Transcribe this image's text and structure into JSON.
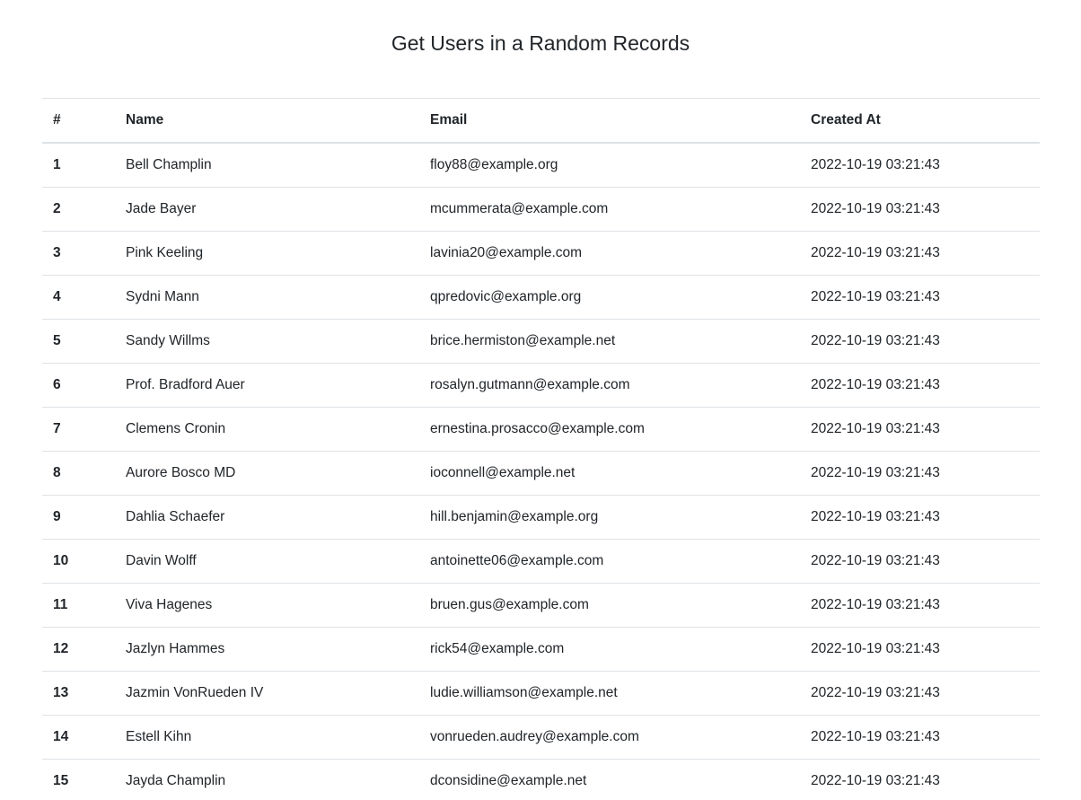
{
  "page": {
    "title": "Get Users in a Random Records"
  },
  "table": {
    "headers": {
      "number": "#",
      "name": "Name",
      "email": "Email",
      "created_at": "Created At"
    },
    "rows": [
      {
        "number": "1",
        "name": "Bell Champlin",
        "email": "floy88@example.org",
        "created_at": "2022-10-19 03:21:43"
      },
      {
        "number": "2",
        "name": "Jade Bayer",
        "email": "mcummerata@example.com",
        "created_at": "2022-10-19 03:21:43"
      },
      {
        "number": "3",
        "name": "Pink Keeling",
        "email": "lavinia20@example.com",
        "created_at": "2022-10-19 03:21:43"
      },
      {
        "number": "4",
        "name": "Sydni Mann",
        "email": "qpredovic@example.org",
        "created_at": "2022-10-19 03:21:43"
      },
      {
        "number": "5",
        "name": "Sandy Willms",
        "email": "brice.hermiston@example.net",
        "created_at": "2022-10-19 03:21:43"
      },
      {
        "number": "6",
        "name": "Prof. Bradford Auer",
        "email": "rosalyn.gutmann@example.com",
        "created_at": "2022-10-19 03:21:43"
      },
      {
        "number": "7",
        "name": "Clemens Cronin",
        "email": "ernestina.prosacco@example.com",
        "created_at": "2022-10-19 03:21:43"
      },
      {
        "number": "8",
        "name": "Aurore Bosco MD",
        "email": "ioconnell@example.net",
        "created_at": "2022-10-19 03:21:43"
      },
      {
        "number": "9",
        "name": "Dahlia Schaefer",
        "email": "hill.benjamin@example.org",
        "created_at": "2022-10-19 03:21:43"
      },
      {
        "number": "10",
        "name": "Davin Wolff",
        "email": "antoinette06@example.com",
        "created_at": "2022-10-19 03:21:43"
      },
      {
        "number": "11",
        "name": "Viva Hagenes",
        "email": "bruen.gus@example.com",
        "created_at": "2022-10-19 03:21:43"
      },
      {
        "number": "12",
        "name": "Jazlyn Hammes",
        "email": "rick54@example.com",
        "created_at": "2022-10-19 03:21:43"
      },
      {
        "number": "13",
        "name": "Jazmin VonRueden IV",
        "email": "ludie.williamson@example.net",
        "created_at": "2022-10-19 03:21:43"
      },
      {
        "number": "14",
        "name": "Estell Kihn",
        "email": "vonrueden.audrey@example.com",
        "created_at": "2022-10-19 03:21:43"
      },
      {
        "number": "15",
        "name": "Jayda Champlin",
        "email": "dconsidine@example.net",
        "created_at": "2022-10-19 03:21:43"
      }
    ]
  }
}
